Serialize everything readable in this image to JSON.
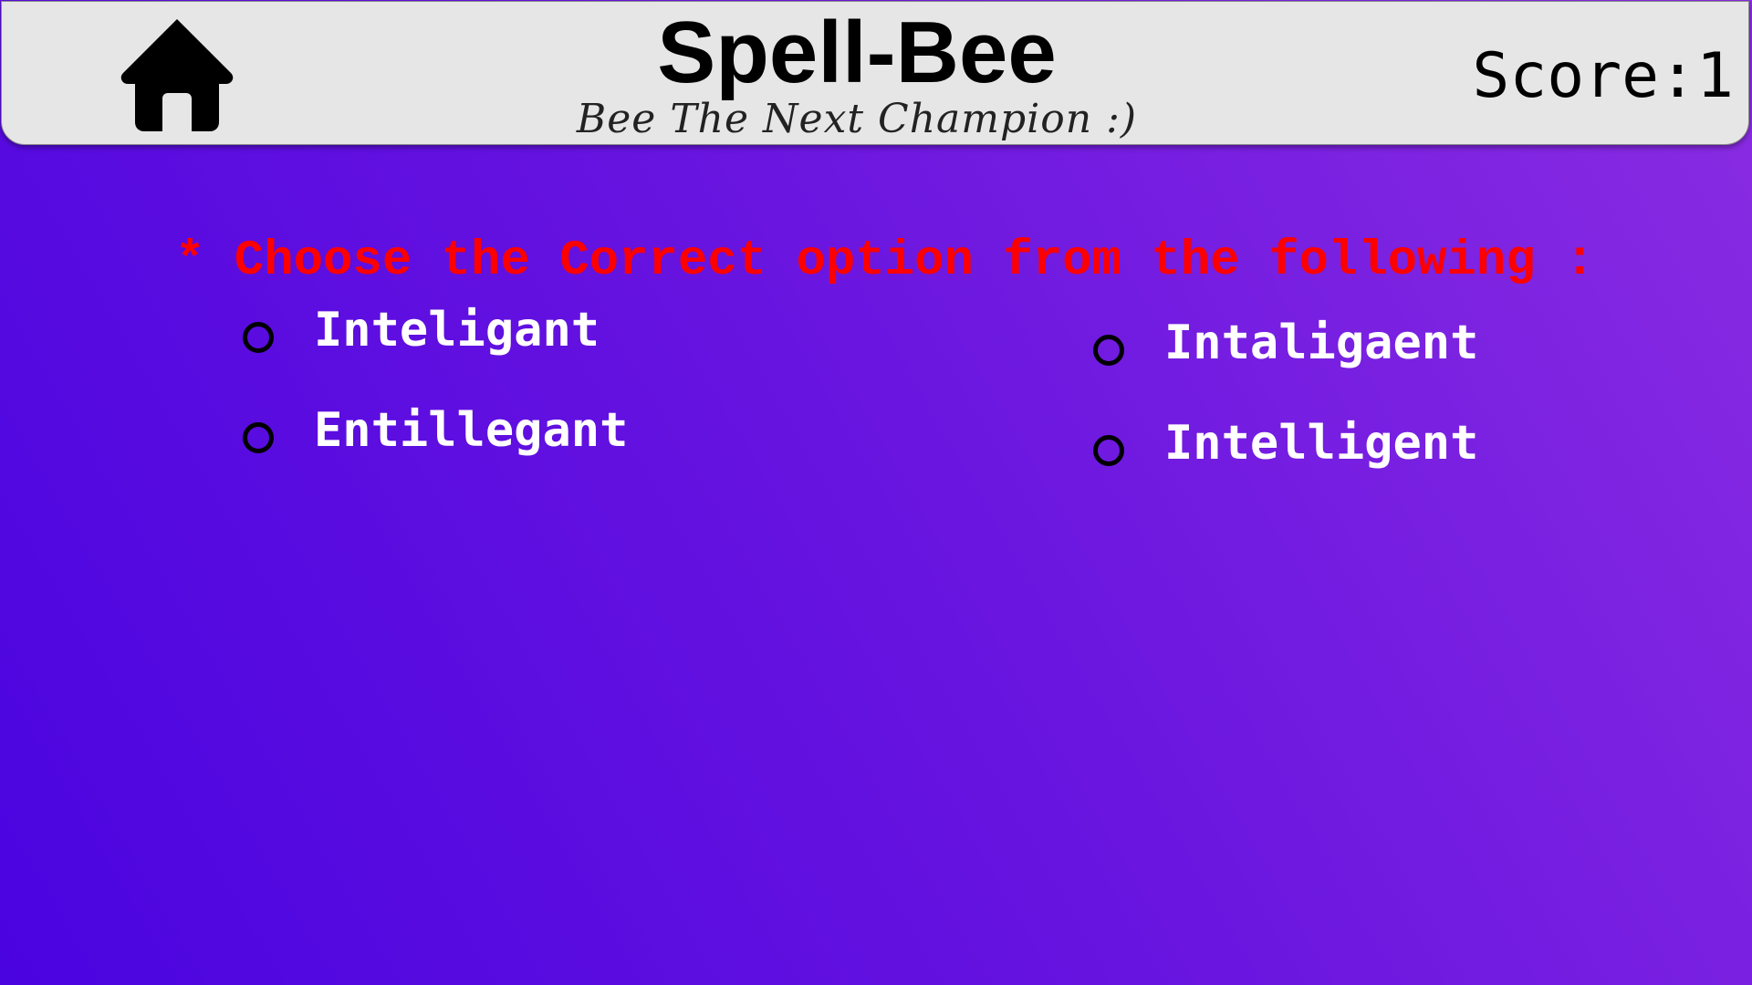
{
  "header": {
    "title": "Spell-Bee",
    "subtitle": "Bee The Next Champion :)",
    "score": "Score:1",
    "home_icon": "home-icon"
  },
  "quiz": {
    "instruction": "* Choose the Correct option from the following :",
    "options": [
      {
        "label": "Inteligant",
        "selected": false
      },
      {
        "label": "Entillegant",
        "selected": false
      },
      {
        "label": "Intaligaent",
        "selected": false
      },
      {
        "label": "Intelligent",
        "selected": false
      }
    ]
  },
  "colors": {
    "header_bg": "#e6e6e6",
    "background_start": "#4a04e0",
    "background_end": "#8a2ce2",
    "instruction": "#ff0000",
    "option_text": "#ffffff"
  }
}
